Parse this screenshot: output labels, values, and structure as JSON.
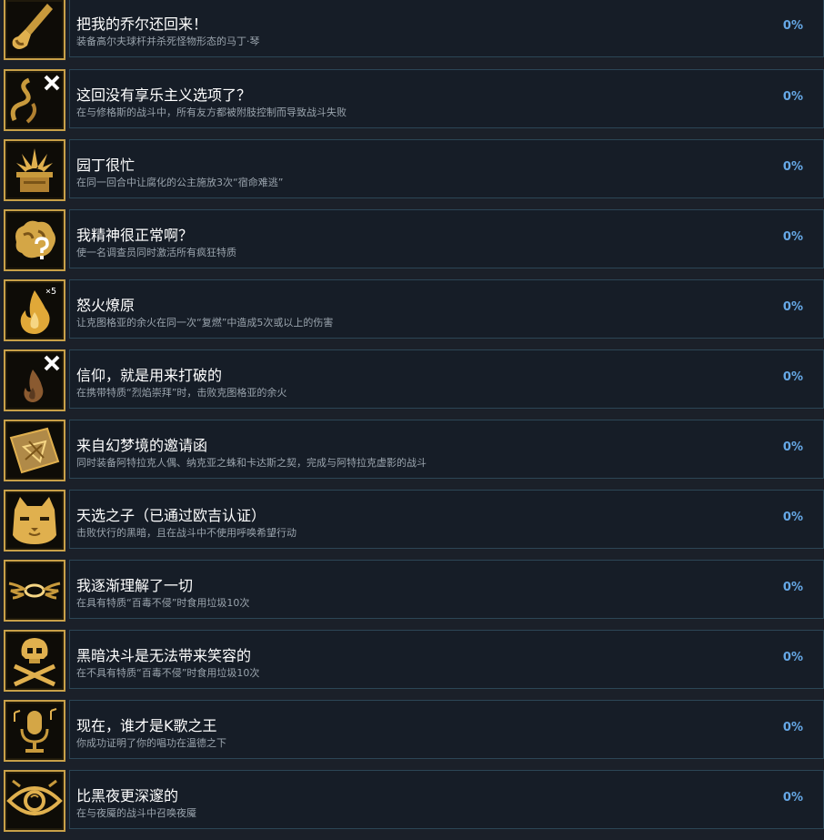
{
  "achievements": [
    {
      "title": "把我的乔尔还回来！",
      "desc": "装备高尔夫球杆并杀死怪物形态的马丁·琴",
      "percent": "0%",
      "icon": "golf-club-icon"
    },
    {
      "title": "这回没有享乐主义选项了？",
      "desc": "在与修格斯的战斗中，所有友方都被附肢控制而导致战斗失败",
      "percent": "0%",
      "icon": "tentacle-cross-icon"
    },
    {
      "title": "园丁很忙",
      "desc": "在同一回合中让腐化的公主施放3次“宿命难逃”",
      "percent": "0%",
      "icon": "potted-plant-icon"
    },
    {
      "title": "我精神很正常啊？",
      "desc": "使一名调查员同时激活所有疯狂特质",
      "percent": "0%",
      "icon": "brain-question-icon"
    },
    {
      "title": "怒火燎原",
      "desc": "让克图格亚的余火在同一次“复燃”中造成5次或以上的伤害",
      "percent": "0%",
      "icon": "fire-x5-icon"
    },
    {
      "title": "信仰，就是用来打破的",
      "desc": "在携带特质“烈焰崇拜”时，击败克图格亚的余火",
      "percent": "0%",
      "icon": "ember-cross-icon"
    },
    {
      "title": "来自幻梦境的邀请函",
      "desc": "同时装备阿特拉克人偶、纳克亚之蛛和卡达斯之契，完成与阿特拉克虚影的战斗",
      "percent": "0%",
      "icon": "envelope-icon"
    },
    {
      "title": "天选之子（已通过欧吉认证）",
      "desc": "击败伏行的黑暗，且在战斗中不使用呼唤希望行动",
      "percent": "0%",
      "icon": "cat-face-icon"
    },
    {
      "title": "我逐渐理解了一切",
      "desc": "在具有特质“百毒不侵”时食用垃圾10次",
      "percent": "0%",
      "icon": "winged-halo-icon"
    },
    {
      "title": "黑暗决斗是无法带来笑容的",
      "desc": "在不具有特质“百毒不侵”时食用垃圾10次",
      "percent": "0%",
      "icon": "skull-crossbones-icon"
    },
    {
      "title": "现在，谁才是K歌之王",
      "desc": "你成功证明了你的唱功在温德之下",
      "percent": "0%",
      "icon": "microphone-icon"
    },
    {
      "title": "比黑夜更深邃的",
      "desc": "在与夜魇的战斗中召唤夜魇",
      "percent": "0%",
      "icon": "eye-icon"
    }
  ]
}
